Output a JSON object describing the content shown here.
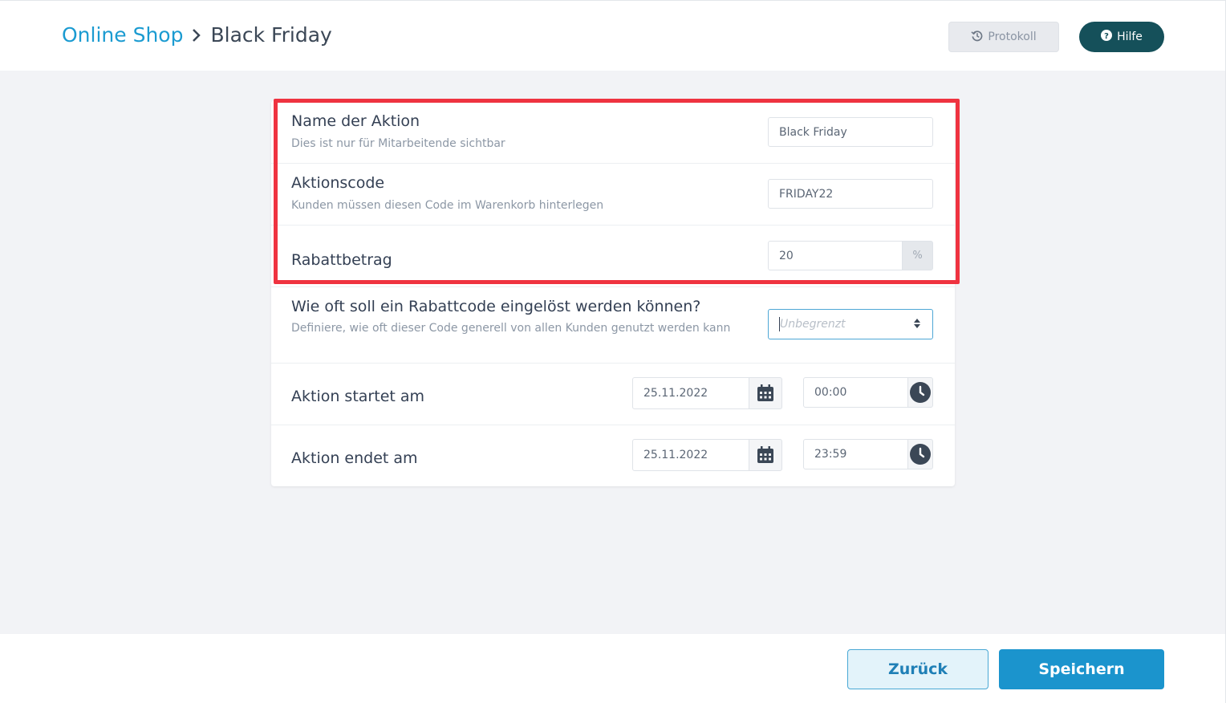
{
  "breadcrumb": {
    "parent": "Online Shop",
    "current": "Black Friday"
  },
  "header_buttons": {
    "protokoll": "Protokoll",
    "hilfe": "Hilfe"
  },
  "form": {
    "name": {
      "label": "Name der Aktion",
      "description": "Dies ist nur für Mitarbeitende sichtbar",
      "value": "Black Friday"
    },
    "code": {
      "label": "Aktionscode",
      "description": "Kunden müssen diesen Code im Warenkorb hinterlegen",
      "value": "FRIDAY22"
    },
    "discount": {
      "label": "Rabattbetrag",
      "value": "20",
      "unit": "%"
    },
    "usage": {
      "label": "Wie oft soll ein Rabattcode eingelöst werden können?",
      "description": "Definiere, wie oft dieser Code generell von allen Kunden genutzt werden kann",
      "placeholder": "Unbegrenzt"
    },
    "start": {
      "label": "Aktion startet am",
      "date": "25.11.2022",
      "time": "00:00"
    },
    "end": {
      "label": "Aktion endet am",
      "date": "25.11.2022",
      "time": "23:59"
    }
  },
  "footer": {
    "back": "Zurück",
    "save": "Speichern"
  },
  "colors": {
    "accent": "#1b94cd",
    "help_button": "#15505a",
    "highlight": "#ef3340"
  },
  "icons": [
    "history-icon",
    "question-circle-icon",
    "chevron-right-icon",
    "calendar-icon",
    "clock-icon",
    "sort-icon"
  ]
}
